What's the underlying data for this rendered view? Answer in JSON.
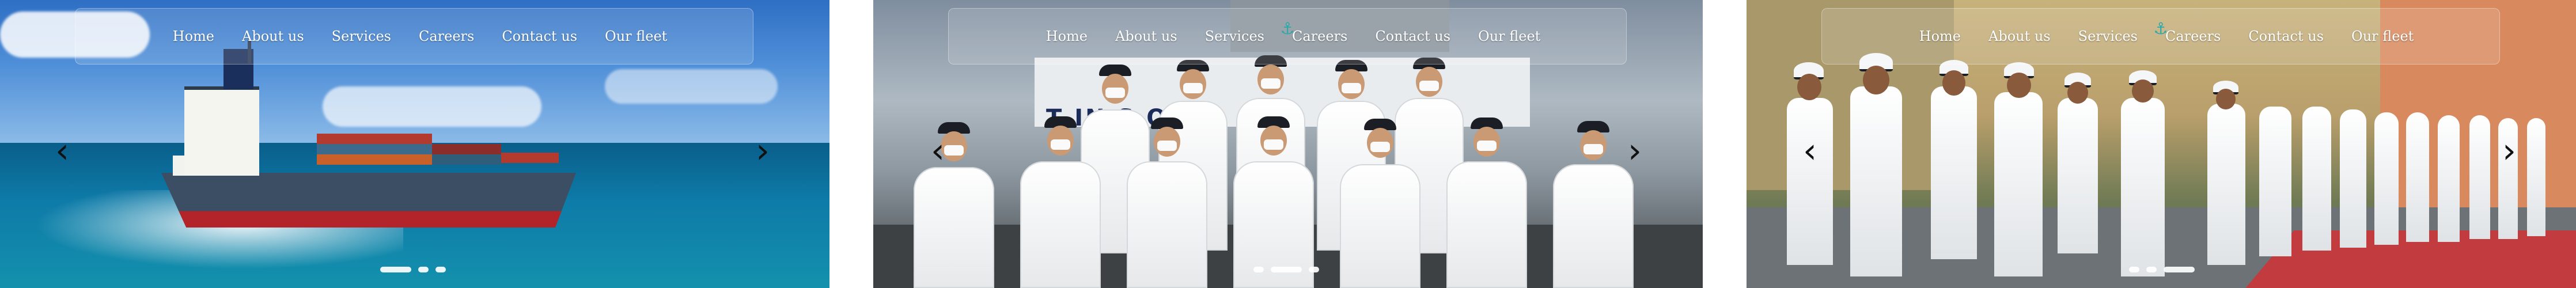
{
  "nav": {
    "items": [
      "Home",
      "About us",
      "Services",
      "Careers",
      "Contact us",
      "Our fleet"
    ],
    "logo_icon": "anchor-icon"
  },
  "carousel": {
    "prev_icon": "chevron-left-icon",
    "next_icon": "chevron-right-icon",
    "prev_glyph": "‹",
    "next_glyph": "›",
    "slide_count": 3
  },
  "slides": [
    {
      "scene": "cargo-ship-at-sea",
      "active_dot": 0
    },
    {
      "scene": "naval-officers-seated",
      "active_dot": 1,
      "banner_text": "T   IN   S   ORO"
    },
    {
      "scene": "naval-cadets-parade",
      "active_dot": 2
    }
  ],
  "colors": {
    "nav_text": "#ffffff",
    "logo": "#2ba8a8",
    "arrow": "#111111"
  }
}
